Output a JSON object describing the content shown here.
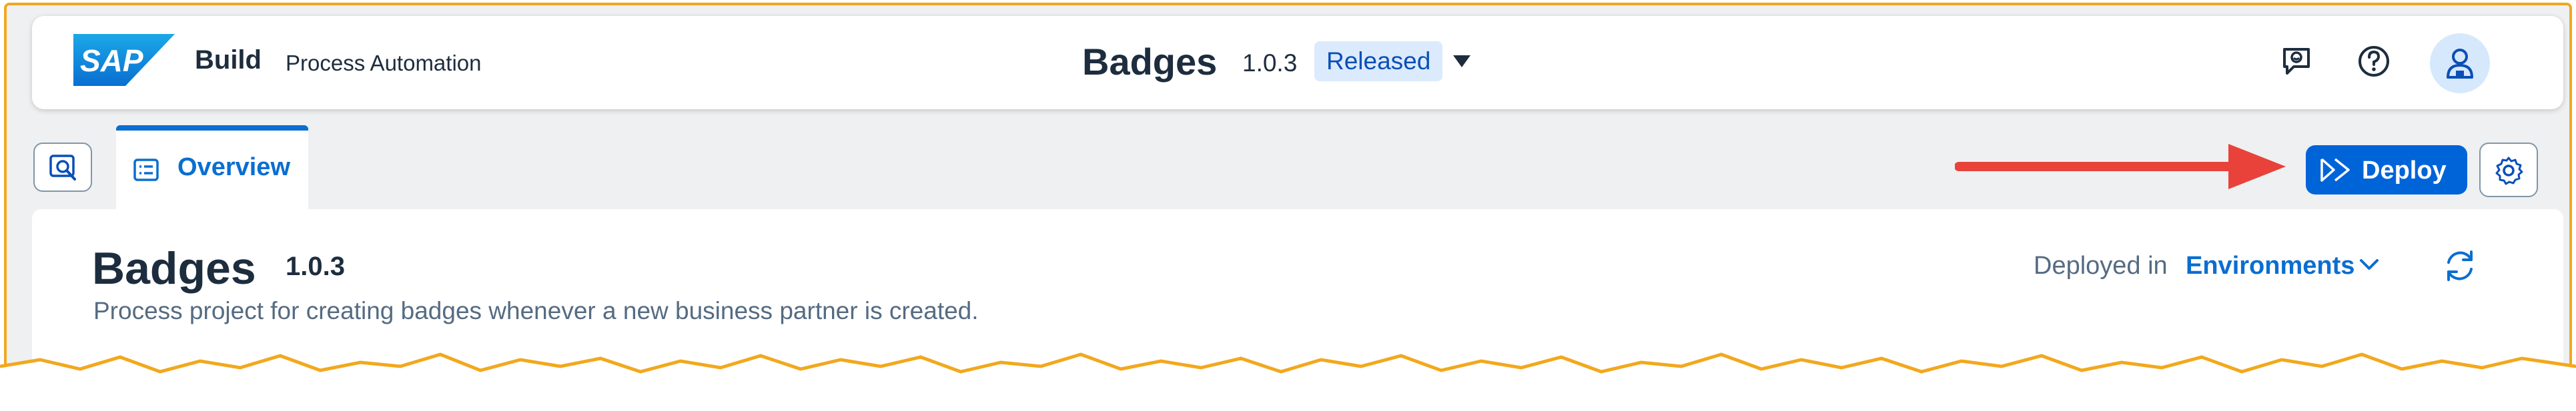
{
  "shell": {
    "logo_text": "SAP",
    "brand": "Build",
    "product": "Process Automation",
    "project_title": "Badges",
    "project_version": "1.0.3",
    "status_badge": "Released",
    "icons": [
      "feedback-icon",
      "help-icon",
      "user-icon"
    ]
  },
  "tabs": {
    "search_icon": "search-icon",
    "items": [
      {
        "label": "Overview",
        "icon": "list-icon"
      }
    ]
  },
  "toolbar": {
    "deploy_label": "Deploy",
    "settings_icon": "gear-icon"
  },
  "project": {
    "title": "Badges",
    "version": "1.0.3",
    "description": "Process project for creating badges whenever a new business partner is created.",
    "deployed_in_label": "Deployed in",
    "environments_label": "Environments"
  },
  "colors": {
    "accent": "#0a6ed1",
    "deploy_button": "#0064d9",
    "annotation_arrow": "#e8423a",
    "frame_border": "#f2a81d"
  }
}
